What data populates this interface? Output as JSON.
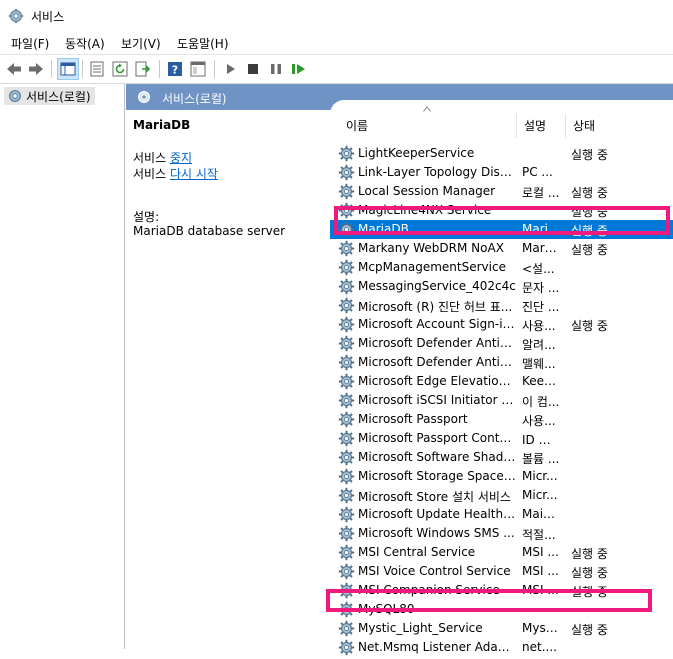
{
  "window": {
    "title": "서비스"
  },
  "menu": [
    {
      "label": "파일(F)"
    },
    {
      "label": "동작(A)"
    },
    {
      "label": "보기(V)"
    },
    {
      "label": "도움말(H)"
    }
  ],
  "toolbar": {
    "icons": [
      "back-icon",
      "forward-icon",
      "show-tree-icon",
      "properties-icon",
      "refresh-icon",
      "export-icon",
      "help-icon",
      "console-icon",
      "start-icon",
      "stop-icon",
      "pause-icon",
      "restart-icon"
    ]
  },
  "tree": {
    "root_label": "서비스(로컬)"
  },
  "pane_header": {
    "title": "서비스(로컬)"
  },
  "detail": {
    "service_name": "MariaDB",
    "stop_prefix": "서비스 ",
    "stop_link": "중지",
    "restart_prefix": "서비스 ",
    "restart_link": "다시 시작",
    "desc_label": "설명:",
    "desc_text": "MariaDB database server"
  },
  "columns": {
    "name": "이름",
    "desc": "설명",
    "status": "상태"
  },
  "services": [
    {
      "name": "LightKeeperService",
      "desc": "",
      "status": "실행 중"
    },
    {
      "name": "Link-Layer Topology Disco...",
      "desc": "PC ...",
      "status": ""
    },
    {
      "name": "Local Session Manager",
      "desc": "로컬 ...",
      "status": "실행 중"
    },
    {
      "name": "MagicLine4NX Service",
      "desc": "",
      "status": "실행 중"
    },
    {
      "name": "MariaDB",
      "desc": "Mari...",
      "status": "실행 중"
    },
    {
      "name": "Markany WebDRM NoAX",
      "desc": "Mark...",
      "status": "실행 중"
    },
    {
      "name": "McpManagementService",
      "desc": "<설...",
      "status": ""
    },
    {
      "name": "MessagingService_402c4c",
      "desc": "문자 ...",
      "status": ""
    },
    {
      "name": "Microsoft (R) 진단 허브 표...",
      "desc": "진단 ...",
      "status": ""
    },
    {
      "name": "Microsoft Account Sign-in ...",
      "desc": "사용...",
      "status": "실행 중"
    },
    {
      "name": "Microsoft Defender Antivir...",
      "desc": "알려...",
      "status": ""
    },
    {
      "name": "Microsoft Defender Antivir...",
      "desc": "맬웨...",
      "status": ""
    },
    {
      "name": "Microsoft Edge Elevation S...",
      "desc": "Keep...",
      "status": ""
    },
    {
      "name": "Microsoft iSCSI Initiator Se...",
      "desc": "이 컴...",
      "status": ""
    },
    {
      "name": "Microsoft Passport",
      "desc": "사용...",
      "status": ""
    },
    {
      "name": "Microsoft Passport Container",
      "desc": "ID 공...",
      "status": ""
    },
    {
      "name": "Microsoft Software Shado...",
      "desc": "볼륨 ...",
      "status": ""
    },
    {
      "name": "Microsoft Storage Spaces ...",
      "desc": "Micr...",
      "status": ""
    },
    {
      "name": "Microsoft Store 설치 서비스",
      "desc": "Micr...",
      "status": ""
    },
    {
      "name": "Microsoft Update Health S...",
      "desc": "Main...",
      "status": ""
    },
    {
      "name": "Microsoft Windows SMS ...",
      "desc": "적절...",
      "status": ""
    },
    {
      "name": "MSI Central Service",
      "desc": "MSI ...",
      "status": "실행 중"
    },
    {
      "name": "MSI Voice Control Service",
      "desc": "MSI ...",
      "status": "실행 중"
    },
    {
      "name": "MSI Companion Service",
      "desc": "MSI ...",
      "status": "실행 중"
    },
    {
      "name": "MySQL80",
      "desc": "",
      "status": ""
    },
    {
      "name": "Mystic_Light_Service",
      "desc": "Myst...",
      "status": "실행 중"
    },
    {
      "name": "Net.Msmq Listener Adapter",
      "desc": "net....",
      "status": ""
    }
  ],
  "selected_service": "MariaDB",
  "colors": {
    "highlight_border": "#f0197d",
    "selection": "#0078d7",
    "header": "#6f93c4"
  }
}
